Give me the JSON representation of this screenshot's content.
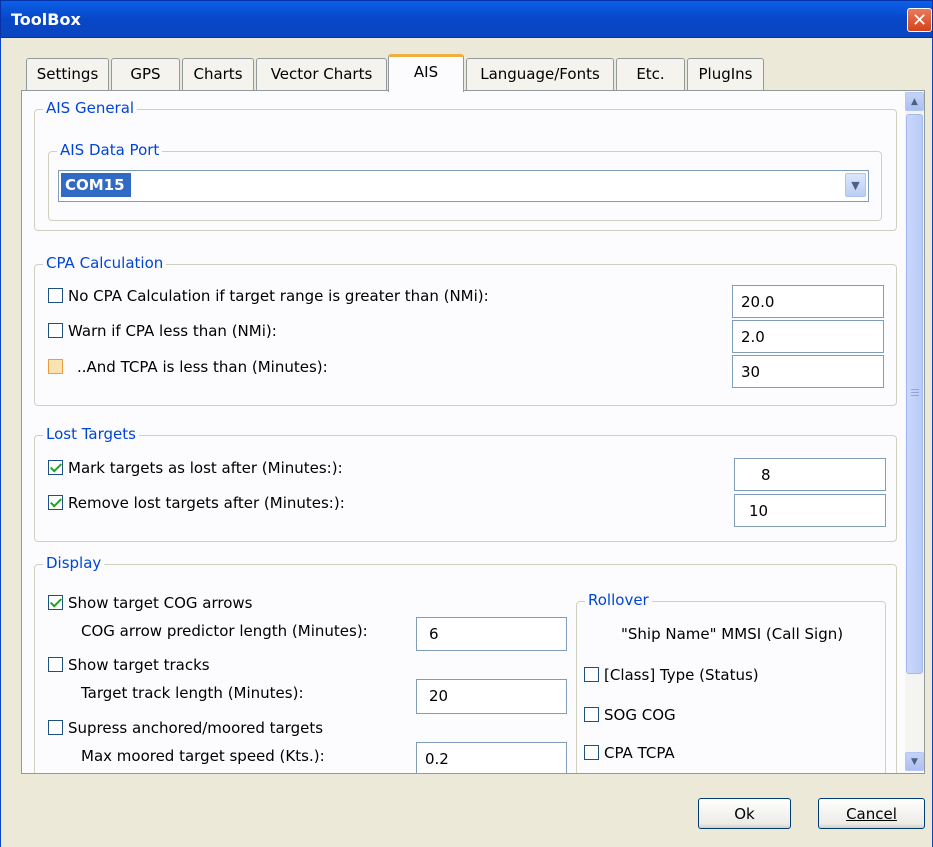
{
  "window": {
    "title": "ToolBox",
    "close_label": "✕"
  },
  "tabs": [
    {
      "label": "Settings",
      "active": false
    },
    {
      "label": "GPS",
      "active": false
    },
    {
      "label": "Charts",
      "active": false
    },
    {
      "label": "Vector Charts",
      "active": false
    },
    {
      "label": "AIS",
      "active": true
    },
    {
      "label": "Language/Fonts",
      "active": false
    },
    {
      "label": "Etc.",
      "active": false
    },
    {
      "label": "PlugIns",
      "active": false
    }
  ],
  "ais_general": {
    "title": "AIS General",
    "data_port": {
      "title": "AIS Data Port",
      "value": "COM15"
    }
  },
  "cpa": {
    "title": "CPA Calculation",
    "rows": [
      {
        "label": "No CPA Calculation if target range is greater than (NMi):",
        "checked": false,
        "value": "20.0"
      },
      {
        "label": "Warn if CPA less than (NMi):",
        "checked": false,
        "value": "2.0"
      },
      {
        "label": "..And TCPA is less than (Minutes):",
        "checked": false,
        "value": "30"
      }
    ]
  },
  "lost_targets": {
    "title": "Lost Targets",
    "rows": [
      {
        "label": "Mark targets as lost after (Minutes:):",
        "checked": true,
        "value": "8"
      },
      {
        "label": "Remove lost targets after (Minutes:):",
        "checked": true,
        "value": "10"
      }
    ]
  },
  "display": {
    "title": "Display",
    "show_cog": {
      "label": "Show target COG arrows",
      "checked": true
    },
    "cog_length": {
      "label": "COG arrow predictor length (Minutes):",
      "value": "6"
    },
    "show_tracks": {
      "label": "Show target tracks",
      "checked": false
    },
    "track_length": {
      "label": "Target track length (Minutes):",
      "value": "20"
    },
    "suppress_moored": {
      "label": "Supress anchored/moored targets",
      "checked": false
    },
    "moored_speed": {
      "label": "Max moored target speed (Kts.):",
      "value": "0.2"
    }
  },
  "rollover": {
    "title": "Rollover",
    "header": "\"Ship Name\" MMSI (Call Sign)",
    "items": [
      {
        "label": "[Class] Type (Status)",
        "checked": false
      },
      {
        "label": "SOG COG",
        "checked": false
      },
      {
        "label": "CPA TCPA",
        "checked": false
      }
    ]
  },
  "buttons": {
    "ok": "Ok",
    "cancel": "Cancel"
  },
  "icons": {
    "combo_arrow": "chevron-down-icon",
    "scroll_up": "arrow-up-icon",
    "scroll_down": "arrow-down-icon"
  },
  "colors": {
    "accent": "#0046d5",
    "selection": "#316ac5",
    "titlebar": "#0747c8"
  }
}
